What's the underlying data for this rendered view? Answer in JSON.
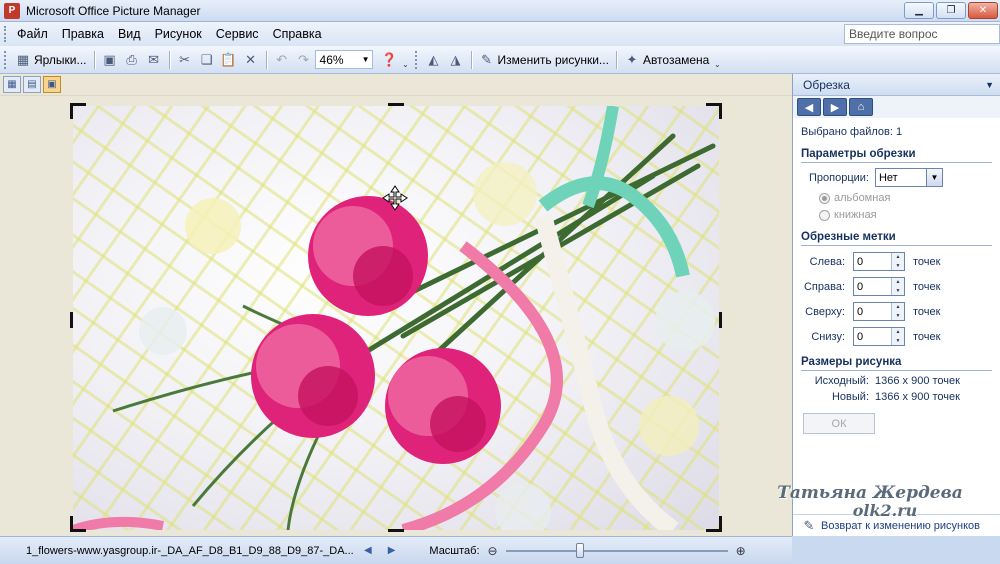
{
  "window": {
    "title": "Microsoft Office Picture Manager",
    "app_icon_glyph": "P"
  },
  "menu": {
    "items": [
      {
        "label": "Файл"
      },
      {
        "label": "Правка"
      },
      {
        "label": "Вид"
      },
      {
        "label": "Рисунок"
      },
      {
        "label": "Сервис"
      },
      {
        "label": "Справка"
      }
    ],
    "help_placeholder": "Введите вопрос"
  },
  "toolbar": {
    "shortcuts_label": "Ярлыки...",
    "zoom_value": "46%",
    "edit_pictures_label": "Изменить рисунки...",
    "autocorrect_label": "Автозамена"
  },
  "task_pane": {
    "title": "Обрезка",
    "selected_files": "Выбрано файлов: 1",
    "crop_settings_header": "Параметры обрезки",
    "aspect_label": "Пропорции:",
    "aspect_value": "Нет",
    "orientation_landscape": "альбомная",
    "orientation_portrait": "книжная",
    "crop_marks_header": "Обрезные метки",
    "margins": {
      "left_label": "Слева:",
      "left_value": "0",
      "right_label": "Справа:",
      "right_value": "0",
      "top_label": "Сверху:",
      "top_value": "0",
      "bottom_label": "Снизу:",
      "bottom_value": "0",
      "unit": "точек"
    },
    "picture_size_header": "Размеры рисунка",
    "original_label": "Исходный:",
    "original_value": "1366 x 900 точек",
    "new_label": "Новый:",
    "new_value": "1366 x 900 точек",
    "ok_label": "ОК",
    "footer_link": "Возврат к изменению рисунков"
  },
  "statusbar": {
    "file_name": "1_flowers-www.yasgroup.ir-_DA_AF_D8_B1_D9_88_D9_87-_DA...",
    "zoom_label": "Масштаб:",
    "zoom_slider_level": 0.33
  },
  "watermark": {
    "line1": "Татьяна Жердева",
    "line2": "olk2.ru"
  },
  "colors": {
    "titlebar": "#cddcf1",
    "pane_text": "#15315e",
    "canvas_bg": "#eae6d8",
    "flower_pink": "#e0237a",
    "ribbon_teal": "#6fd3b9"
  }
}
